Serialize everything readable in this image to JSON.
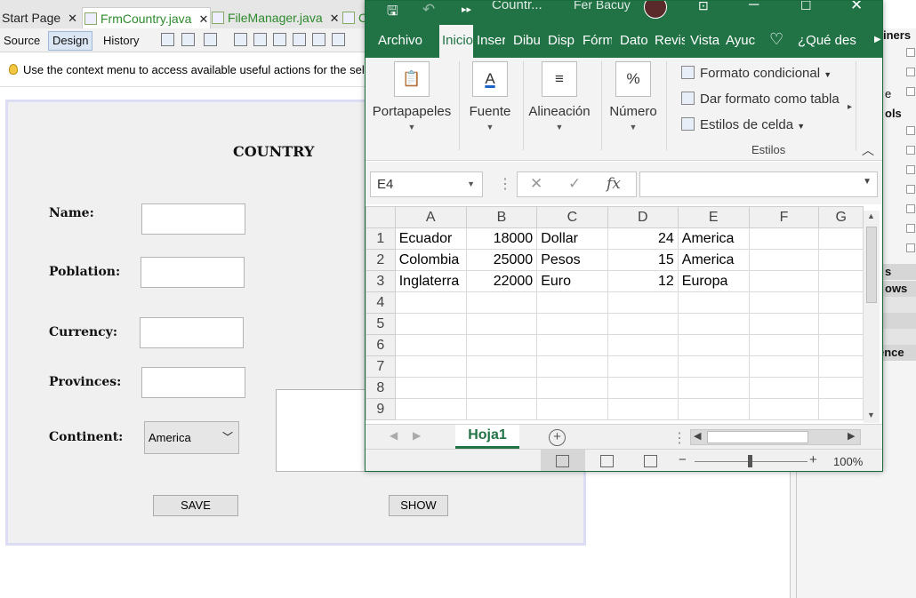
{
  "ide": {
    "tabs": [
      {
        "label": "Start Page"
      },
      {
        "label": "FrmCountry.java"
      },
      {
        "label": "FileManager.java"
      },
      {
        "label": "C"
      }
    ],
    "toolbar": {
      "source": "Source",
      "design": "Design",
      "history": "History"
    },
    "hint": "Use the context menu to access available useful actions for the sele"
  },
  "form": {
    "title": "COUNTRY",
    "labels": {
      "name": "Name:",
      "poblation": "Poblation:",
      "currency": "Currency:",
      "provinces": "Provinces:",
      "continent": "Continent:"
    },
    "continent_value": "America",
    "save_label": "SAVE",
    "show_label": "SHOW"
  },
  "palette": {
    "items": [
      "iners",
      "e",
      "ols",
      "s",
      "ows",
      "ence"
    ]
  },
  "excel": {
    "title": "Countr...",
    "user": "Fer Bacuy",
    "tabs": [
      "Archivo",
      "Inicio",
      "Inser",
      "Dibu",
      "Disp",
      "Fórm",
      "Dato",
      "Revis",
      "Vista",
      "Ayuc"
    ],
    "tell_me": "¿Qué des",
    "ribbon": {
      "portapapeles": "Portapapeles",
      "fuente": "Fuente",
      "alineacion": "Alineación",
      "numero": "Número",
      "formato_condicional": "Formato condicional",
      "dar_formato": "Dar formato como tabla",
      "estilos_celda": "Estilos de celda",
      "estilos": "Estilos"
    },
    "namebox": "E4",
    "columns": [
      "A",
      "B",
      "C",
      "D",
      "E",
      "F",
      "G"
    ],
    "rows": [
      [
        "1",
        "Ecuador",
        "18000",
        "Dollar",
        "24",
        "America",
        "",
        ""
      ],
      [
        "2",
        "Colombia",
        "25000",
        "Pesos",
        "15",
        "America",
        "",
        ""
      ],
      [
        "3",
        "Inglaterra",
        "22000",
        "Euro",
        "12",
        "Europa",
        "",
        ""
      ],
      [
        "4",
        "",
        "",
        "",
        "",
        "",
        "",
        ""
      ],
      [
        "5",
        "",
        "",
        "",
        "",
        "",
        "",
        ""
      ],
      [
        "6",
        "",
        "",
        "",
        "",
        "",
        "",
        ""
      ],
      [
        "7",
        "",
        "",
        "",
        "",
        "",
        "",
        ""
      ],
      [
        "8",
        "",
        "",
        "",
        "",
        "",
        "",
        ""
      ],
      [
        "9",
        "",
        "",
        "",
        "",
        "",
        "",
        ""
      ]
    ],
    "sheet": "Hoja1",
    "zoom": "100%",
    "colors": {
      "accent": "#217346"
    }
  }
}
